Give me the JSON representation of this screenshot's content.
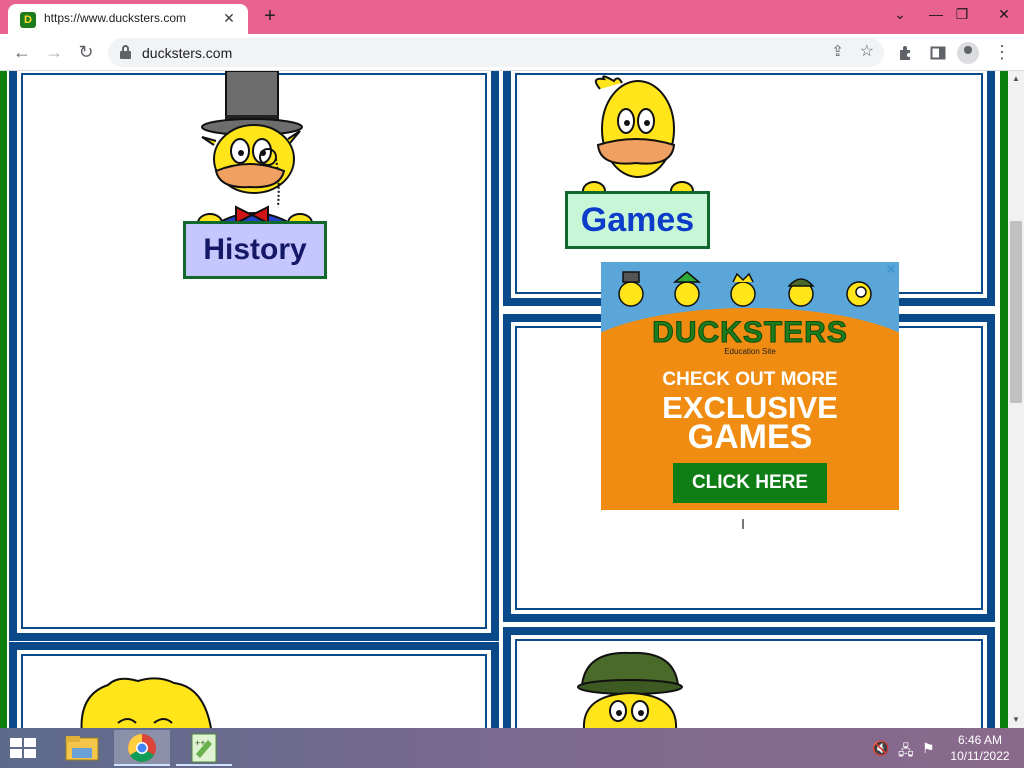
{
  "browser": {
    "tab_title": "https://www.ducksters.com",
    "tab_favicon": "D",
    "url": "ducksters.com",
    "window_controls": {
      "tab_search": "⌄",
      "minimize": "—",
      "restore": "❐",
      "close": "✕"
    }
  },
  "page": {
    "panels": [
      {
        "id": "history",
        "sign_text": "History"
      },
      {
        "id": "games",
        "sign_text": "Games"
      }
    ],
    "ad": {
      "brand": "DUCKSTERS",
      "brand_sub": "Education Site",
      "line1": "CHECK OUT MORE",
      "line2": "EXCLUSIVE",
      "line3": "GAMES",
      "button": "CLICK HERE",
      "close": "✕"
    }
  },
  "taskbar": {
    "time": "6:46 AM",
    "date": "10/11/2022"
  },
  "colors": {
    "chrome_frame": "#e8638f",
    "panel_border": "#0a4a8a",
    "side_green": "#0c7e0c",
    "ad_orange": "#f08c12",
    "ad_button": "#0f7d16"
  }
}
